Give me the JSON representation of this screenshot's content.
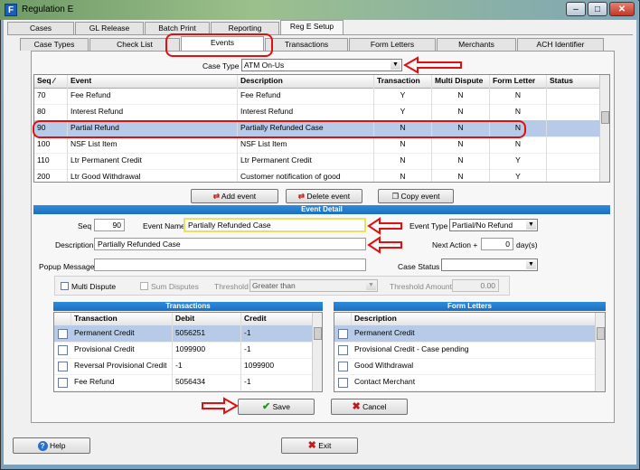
{
  "window": {
    "title": "Regulation E"
  },
  "main_tabs": [
    "Cases",
    "GL Release",
    "Batch Print",
    "Reporting",
    "Reg E Setup"
  ],
  "sub_tabs": [
    "Case Types",
    "Check List",
    "Events",
    "Transactions",
    "Form Letters",
    "Merchants",
    "ACH Identifier"
  ],
  "case_type": {
    "label": "Case Type",
    "value": "ATM On-Us"
  },
  "events_grid": {
    "columns": [
      "Seq",
      "Event",
      "Description",
      "Transaction",
      "Multi Dispute",
      "Form Letter",
      "Status"
    ],
    "rows": [
      [
        "70",
        "Fee Refund",
        "Fee Refund",
        "Y",
        "N",
        "N",
        ""
      ],
      [
        "80",
        "Interest Refund",
        "Interest Refund",
        "Y",
        "N",
        "N",
        ""
      ],
      [
        "90",
        "Partial Refund",
        "Partially Refunded Case",
        "N",
        "N",
        "N",
        ""
      ],
      [
        "100",
        "NSF List Item",
        "NSF List Item",
        "N",
        "N",
        "N",
        ""
      ],
      [
        "110",
        "Ltr Permanent Credit",
        "Ltr Permanent Credit",
        "N",
        "N",
        "Y",
        ""
      ],
      [
        "200",
        "Ltr Good Withdrawal",
        "Customer notification of good",
        "N",
        "N",
        "Y",
        ""
      ]
    ]
  },
  "grid_buttons": {
    "add": "Add event",
    "delete": "Delete event",
    "copy": "Copy event"
  },
  "event_detail": {
    "title": "Event Detail",
    "seq_label": "Seq",
    "seq_value": "90",
    "name_label": "Event Name",
    "name_value": "Partially Refunded Case",
    "desc_label": "Description",
    "desc_value": "Partially Refunded Case",
    "popup_label": "Popup Message",
    "popup_value": "",
    "type_label": "Event Type",
    "type_value": "Partial/No Refund",
    "next_action_label": "Next Action +",
    "next_action_value": "0",
    "days_label": "day(s)",
    "case_status_label": "Case Status",
    "case_status_value": "",
    "multi_dispute_label": "Multi Dispute",
    "sum_disputes_label": "Sum Disputes",
    "threshold_label": "Threshold",
    "threshold_value": "Greater than",
    "threshold_amount_label": "Threshold Amount",
    "threshold_amount_value": "0.00"
  },
  "transactions": {
    "title": "Transactions",
    "columns": [
      "Transaction",
      "Debit",
      "Credit"
    ],
    "rows": [
      [
        "Permanent Credit",
        "5056251",
        "-1"
      ],
      [
        "Provisional Credit",
        "1099900",
        "-1"
      ],
      [
        "Reversal Provisional Credit",
        "-1",
        "1099900"
      ],
      [
        "Fee Refund",
        "5056434",
        "-1"
      ]
    ]
  },
  "form_letters": {
    "title": "Form Letters",
    "columns": [
      "Description"
    ],
    "rows": [
      "Permanent Credit",
      "Provisional Credit - Case pending",
      "Good Withdrawal",
      "Contact Merchant"
    ]
  },
  "actions": {
    "save": "Save",
    "cancel": "Cancel",
    "help": "Help",
    "exit": "Exit"
  },
  "colors": {
    "annotation_red": "#e01010",
    "header_blue": "#1d6fbe",
    "selection": "#b7cbe8"
  }
}
